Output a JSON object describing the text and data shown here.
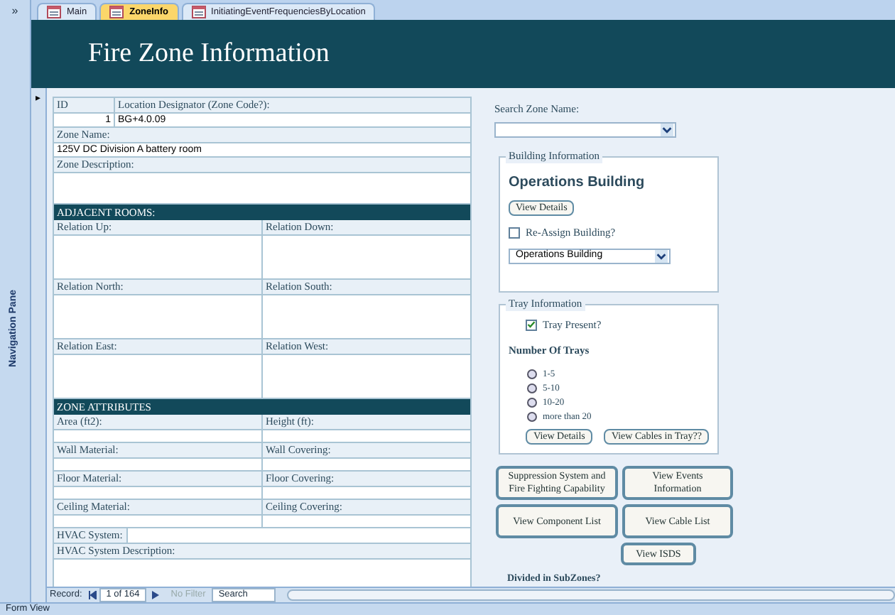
{
  "nav_pane": {
    "toggle": "»",
    "label": "Navigation Pane"
  },
  "tabs": [
    {
      "label": "Main",
      "selected": false
    },
    {
      "label": "ZoneInfo",
      "selected": true
    },
    {
      "label": "InitiatingEventFrequenciesByLocation",
      "selected": false
    }
  ],
  "form_title": "Fire Zone Information",
  "record_selector": "▸",
  "left_form": {
    "rows": [
      {
        "kind": "labels",
        "cells": [
          "ID",
          "Location Designator (Zone Code?):"
        ]
      },
      {
        "kind": "values",
        "cells": [
          "1",
          "BG+4.0.09"
        ]
      },
      {
        "kind": "label",
        "text": "Zone Name:"
      },
      {
        "kind": "value",
        "text": "125V DC Division A battery room"
      },
      {
        "kind": "label",
        "text": "Zone Description:"
      },
      {
        "kind": "blank"
      },
      {
        "kind": "section",
        "text": "ADJACENT ROOMS:"
      },
      {
        "kind": "pair",
        "cells": [
          "Relation Up:",
          "Relation Down:"
        ]
      },
      {
        "kind": "blankpair"
      },
      {
        "kind": "pair",
        "cells": [
          "Relation North:",
          "Relation South:"
        ]
      },
      {
        "kind": "blankpair"
      },
      {
        "kind": "pair",
        "cells": [
          "Relation East:",
          "Relation West:"
        ]
      },
      {
        "kind": "blankpair"
      },
      {
        "kind": "section",
        "text": "ZONE ATTRIBUTES"
      },
      {
        "kind": "pair",
        "cells": [
          "Area (ft2):",
          "Height (ft):"
        ]
      },
      {
        "kind": "emptypair"
      },
      {
        "kind": "pair",
        "cells": [
          "Wall Material:",
          "Wall Covering:"
        ]
      },
      {
        "kind": "emptypair"
      },
      {
        "kind": "pair",
        "cells": [
          "Floor Material:",
          "Floor Covering:"
        ]
      },
      {
        "kind": "emptypair"
      },
      {
        "kind": "pair",
        "cells": [
          "Ceiling Material:",
          "Ceiling Covering:"
        ]
      },
      {
        "kind": "emptypair"
      },
      {
        "kind": "inline",
        "text": "HVAC System:"
      },
      {
        "kind": "label",
        "text": "HVAC System Description:"
      },
      {
        "kind": "blank"
      }
    ]
  },
  "search": {
    "label": "Search Zone Name:"
  },
  "building": {
    "legend": "Building Information",
    "name": "Operations Building",
    "button": "View Details",
    "reassign": {
      "label": "Re-Assign Building?",
      "checked": false
    },
    "select_value": "Operations Building"
  },
  "tray": {
    "legend": "Tray Information",
    "present": {
      "label": "Tray Present?",
      "checked": true
    },
    "heading": "Number Of Trays",
    "options": [
      {
        "label": "1-5",
        "selected": false
      },
      {
        "label": "5-10",
        "selected": false
      },
      {
        "label": "10-20",
        "selected": false
      },
      {
        "label": "more than 20",
        "selected": false
      }
    ],
    "buttons": [
      "View Details",
      "View Cables in Tray??"
    ]
  },
  "actions": [
    "Suppression System and Fire Fighting Capability",
    "View Events Information",
    "View Component List",
    "View Cable List",
    "View ISDS"
  ],
  "subzones_label": "Divided in SubZones?",
  "record_nav": {
    "label": "Record:",
    "position": "1 of 164",
    "filter": "No Filter",
    "search": "Search"
  },
  "status_bar": "Form View"
}
